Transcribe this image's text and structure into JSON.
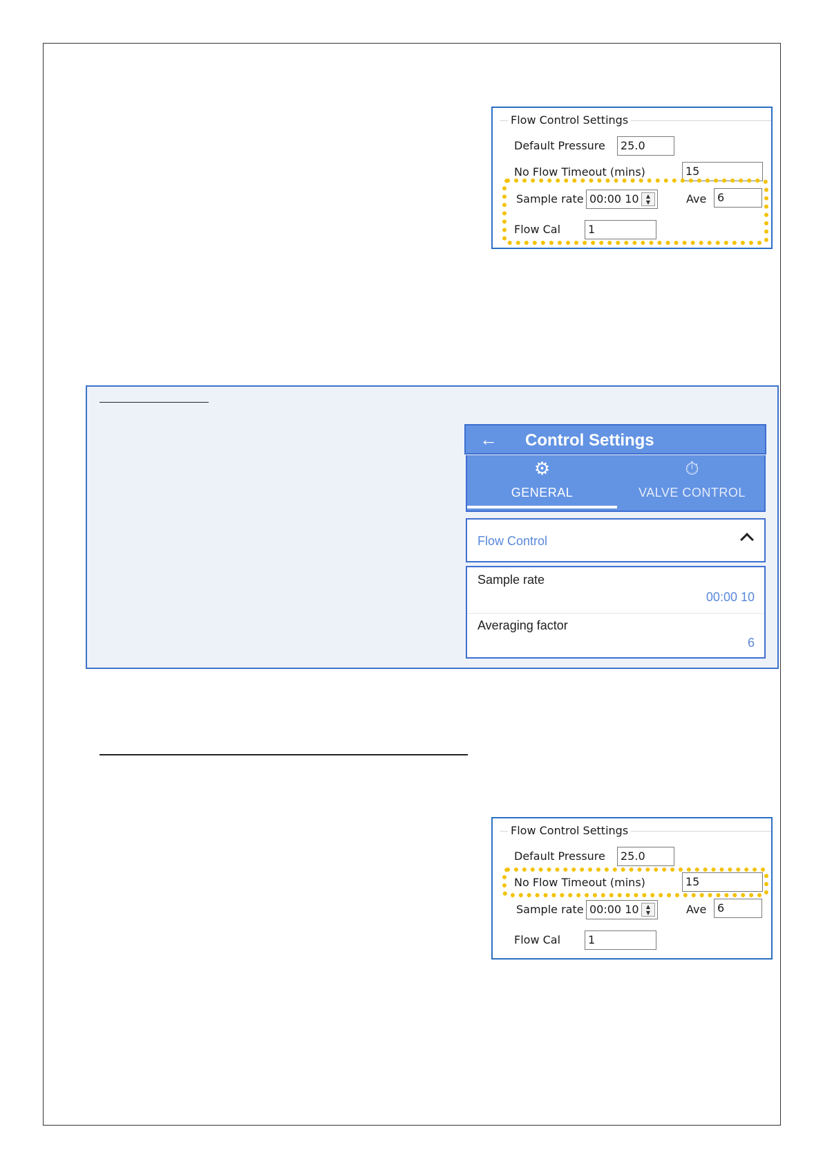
{
  "top_panel": {
    "group_title": "Flow Control Settings",
    "default_pressure_label": "Default Pressure",
    "default_pressure_value": "25.0",
    "no_flow_timeout_label": "No Flow Timeout (mins)",
    "no_flow_timeout_value": "15",
    "sample_rate_label": "Sample rate",
    "sample_rate_value": "00:00 10",
    "ave_label": "Ave",
    "ave_value": "6",
    "flow_cal_label": "Flow Cal",
    "flow_cal_value": "1"
  },
  "app": {
    "header_title": "Control Settings",
    "tabs": [
      {
        "label": "GENERAL",
        "icon": "gear-icon",
        "selected": true
      },
      {
        "label": "VALVE CONTROL",
        "icon": "stopwatch-icon",
        "selected": false
      }
    ],
    "accordion_title": "Flow Control",
    "settings": [
      {
        "label": "Sample rate",
        "value": "00:00 10"
      },
      {
        "label": "Averaging factor",
        "value": "6"
      }
    ]
  },
  "bottom_panel": {
    "group_title": "Flow Control Settings",
    "default_pressure_label": "Default Pressure",
    "default_pressure_value": "25.0",
    "no_flow_timeout_label": "No Flow Timeout (mins)",
    "no_flow_timeout_value": "15",
    "sample_rate_label": "Sample rate",
    "sample_rate_value": "00:00 10",
    "ave_label": "Ave",
    "ave_value": "6",
    "flow_cal_label": "Flow Cal",
    "flow_cal_value": "1"
  },
  "colors": {
    "highlight": "#f2c200",
    "app_blue": "#6393e3",
    "border_blue": "#2b6fc4",
    "panel_bg": "#edf2f9"
  }
}
